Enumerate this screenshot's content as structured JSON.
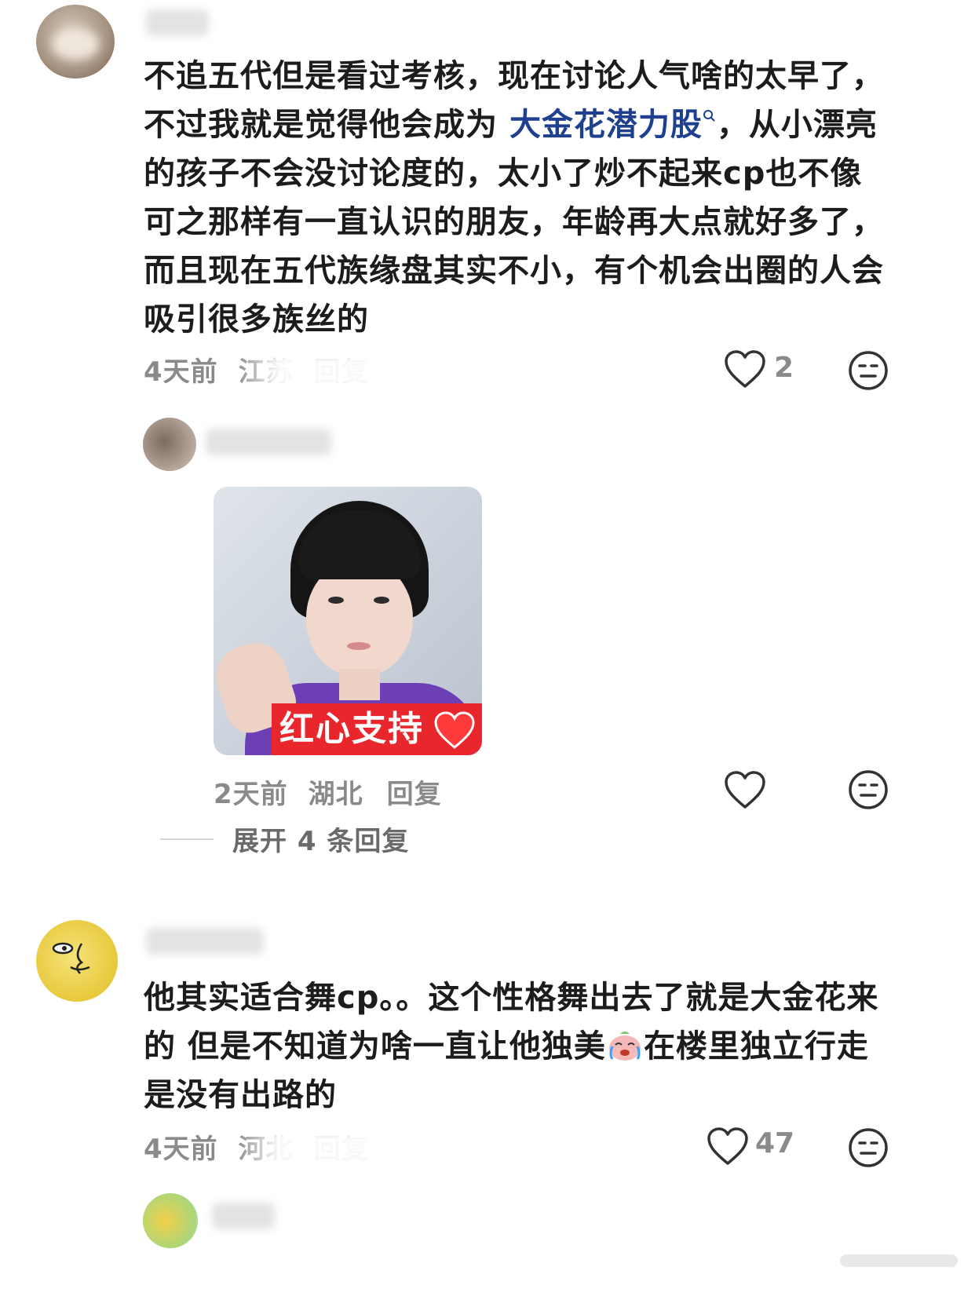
{
  "comments": [
    {
      "text_parts": [
        "不追五代但是看过考核，现在讨论人气啥的太早了，不过我就是觉得他会成为 ",
        "大金花潜力股",
        "，从小漂亮的孩子不会没讨论度的，太小了炒不起来cp也不像可之那样有一直认识的朋友，年龄再大点就好多了，而且现在五代族缘盘其实不小，有个机会出圈的人会吸引很多族丝的"
      ],
      "time": "4天前",
      "location": "江苏",
      "reply_label": "回复",
      "likes": "2"
    },
    {
      "sticker_caption": "红心支持",
      "time": "2天前",
      "location": "湖北",
      "reply_label": "回复",
      "expand_label": "展开 4 条回复"
    },
    {
      "text_parts": [
        "他其实适合舞cp。。这个性格舞出去了就是大金花来的 但是不知道为啥一直让他独美",
        "在楼里独立行走是没有出路的"
      ],
      "time": "4天前",
      "location": "河北",
      "reply_label": "回复",
      "likes": "47"
    }
  ],
  "icons": {
    "search_suffix": "search-icon",
    "heart": "heart-outline-icon",
    "face": "neutral-face-icon",
    "emoji": "crying-peach-emoji"
  }
}
